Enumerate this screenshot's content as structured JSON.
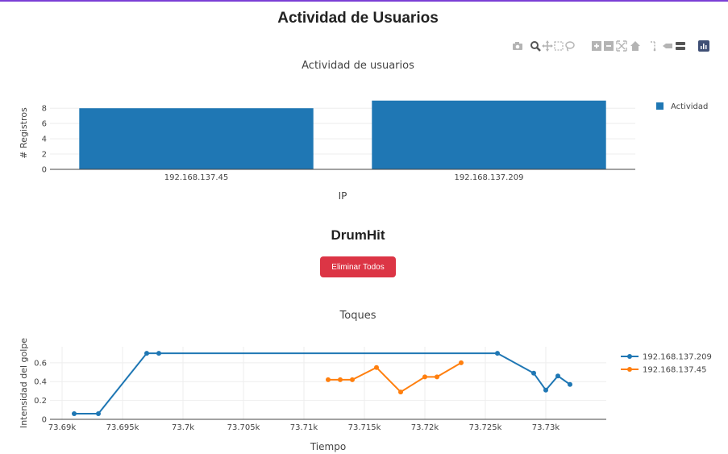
{
  "page": {
    "title": "Actividad de Usuarios"
  },
  "section": {
    "title": "DrumHit"
  },
  "delete_button": {
    "label": "Eliminar Todos"
  },
  "modebar": {
    "icons": [
      "camera-icon",
      "zoom-icon",
      "pan-icon",
      "box-select-icon",
      "lasso-icon",
      "zoom-in-icon",
      "zoom-out-icon",
      "autoscale-icon",
      "reset-axes-icon",
      "spike-lines-icon",
      "hover-closest-icon",
      "hover-compare-icon",
      "plotly-logo-icon"
    ]
  },
  "chart_data": [
    {
      "type": "bar",
      "title": "Actividad de usuarios",
      "xlabel": "IP",
      "ylabel": "# Registros",
      "categories": [
        "192.168.137.45",
        "192.168.137.209"
      ],
      "series": [
        {
          "name": "Actividad",
          "values": [
            8,
            9
          ],
          "color": "#1f77b4"
        }
      ],
      "ylim": [
        0,
        9.5
      ],
      "yticks": [
        0,
        2,
        4,
        6,
        8
      ],
      "ytick_labels": [
        "0",
        "2",
        "4",
        "6",
        "8"
      ],
      "grid": true,
      "legend": "top-right"
    },
    {
      "type": "line",
      "title": "Toques",
      "xlabel": "Tiempo",
      "ylabel": "Intensidad del golpe",
      "xlim": [
        73689,
        73735
      ],
      "ylim": [
        0,
        0.77
      ],
      "xticks": [
        73690,
        73695,
        73700,
        73705,
        73710,
        73715,
        73720,
        73725,
        73730
      ],
      "xtick_labels": [
        "73.69k",
        "73.695k",
        "73.7k",
        "73.705k",
        "73.71k",
        "73.715k",
        "73.72k",
        "73.725k",
        "73.73k"
      ],
      "yticks": [
        0,
        0.2,
        0.4,
        0.6
      ],
      "ytick_labels": [
        "0",
        "0.2",
        "0.4",
        "0.6"
      ],
      "grid": true,
      "legend": "top-right",
      "series": [
        {
          "name": "192.168.137.209",
          "color": "#1f77b4",
          "x": [
            73691,
            73693,
            73697,
            73698,
            73726,
            73729,
            73730,
            73731,
            73732
          ],
          "y": [
            0.06,
            0.06,
            0.7,
            0.7,
            0.7,
            0.49,
            0.31,
            0.46,
            0.37
          ]
        },
        {
          "name": "192.168.137.45",
          "color": "#ff7f0e",
          "x": [
            73712,
            73713,
            73714,
            73716,
            73718,
            73720,
            73721,
            73723
          ],
          "y": [
            0.42,
            0.42,
            0.42,
            0.55,
            0.29,
            0.45,
            0.45,
            0.6
          ]
        }
      ]
    }
  ]
}
